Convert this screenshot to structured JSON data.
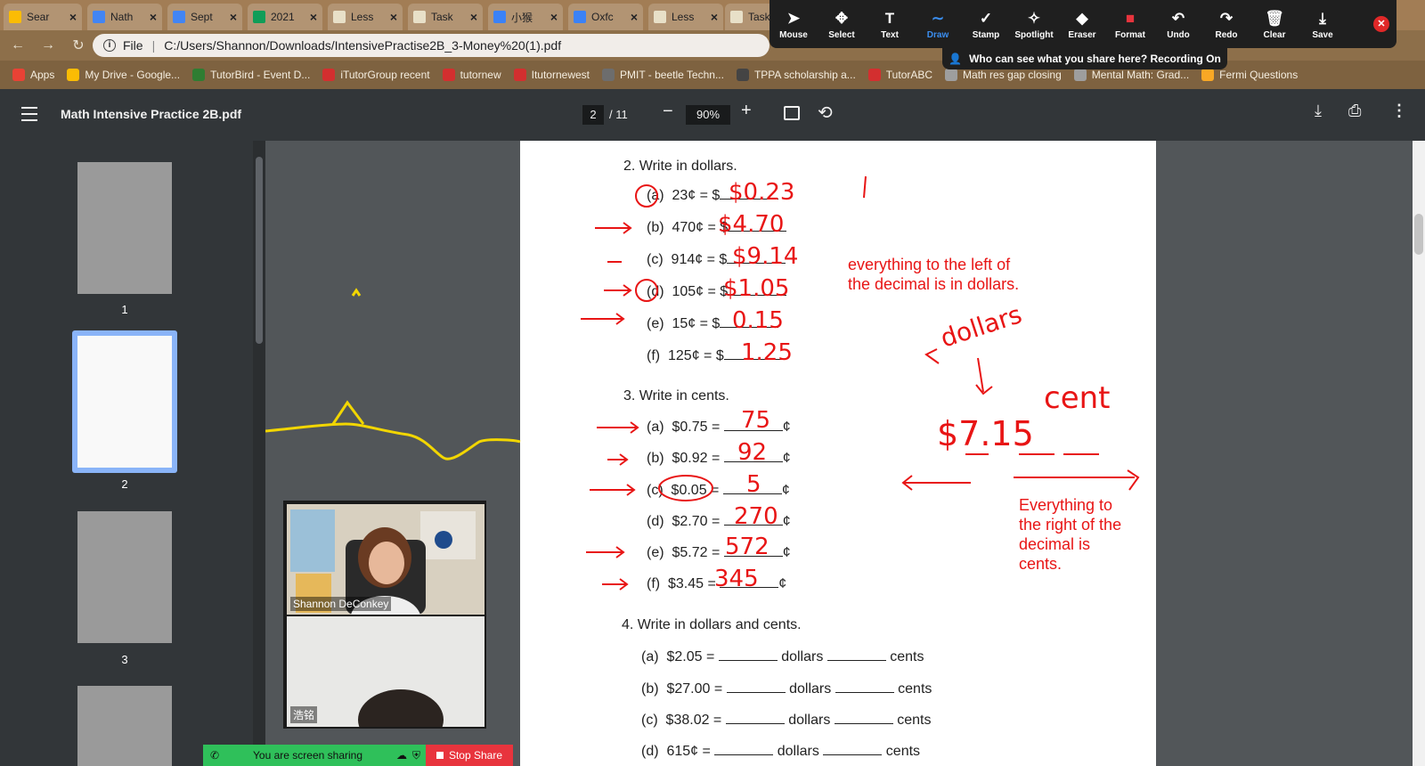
{
  "browser": {
    "tabs": [
      {
        "label": "Sear",
        "icon_color": "#fbbc04"
      },
      {
        "label": "Nath",
        "icon_color": "#4285f4"
      },
      {
        "label": "Sept",
        "icon_color": "#4285f4"
      },
      {
        "label": "2021",
        "icon_color": "#0f9d58"
      },
      {
        "label": "Less",
        "icon_color": "#e8e0c8"
      },
      {
        "label": "Task",
        "icon_color": "#e8e0c8"
      },
      {
        "label": "小猴",
        "icon_color": "#3b82f6"
      },
      {
        "label": "Oxfc",
        "icon_color": "#3b82f6"
      },
      {
        "label": "Less",
        "icon_color": "#e8e0c8"
      },
      {
        "label": "Task",
        "icon_color": "#e8e0c8"
      }
    ],
    "address": {
      "prefix": "File",
      "url": "C:/Users/Shannon/Downloads/IntensivePractise2B_3-Money%20(1).pdf"
    },
    "bookmarks": [
      {
        "label": "Apps",
        "icon_color": "#e94235"
      },
      {
        "label": "My Drive - Google...",
        "icon_color": "#fbbc04"
      },
      {
        "label": "TutorBird - Event D...",
        "icon_color": "#2e7d32"
      },
      {
        "label": "iTutorGroup recent",
        "icon_color": "#d32f2f"
      },
      {
        "label": "tutornew",
        "icon_color": "#d32f2f"
      },
      {
        "label": "Itutornewest",
        "icon_color": "#d32f2f"
      },
      {
        "label": "PMIT - beetle Techn...",
        "icon_color": "#6d6d6d"
      },
      {
        "label": "TPPA scholarship a...",
        "icon_color": "#444444"
      },
      {
        "label": "TutorABC",
        "icon_color": "#d32f2f"
      },
      {
        "label": "Math res gap closing",
        "icon_color": "#9e9e9e"
      },
      {
        "label": "Mental Math: Grad...",
        "icon_color": "#9e9e9e"
      },
      {
        "label": "Fermi Questions",
        "icon_color": "#f9a825"
      }
    ]
  },
  "zoom_annotate": {
    "tools": [
      {
        "label": "Mouse",
        "icon": "cursor-icon",
        "glyph": "➤",
        "active": false
      },
      {
        "label": "Select",
        "icon": "select-move-icon",
        "glyph": "✥",
        "active": false
      },
      {
        "label": "Text",
        "icon": "text-icon",
        "glyph": "T",
        "active": false
      },
      {
        "label": "Draw",
        "icon": "draw-icon",
        "glyph": "∼",
        "active": true
      },
      {
        "label": "Stamp",
        "icon": "stamp-check-icon",
        "glyph": "✓",
        "active": false
      },
      {
        "label": "Spotlight",
        "icon": "spotlight-icon",
        "glyph": "✧",
        "active": false
      },
      {
        "label": "Eraser",
        "icon": "eraser-icon",
        "glyph": "◆",
        "active": false
      },
      {
        "label": "Format",
        "icon": "format-color-icon",
        "glyph": "■",
        "active": false
      },
      {
        "label": "Undo",
        "icon": "undo-icon",
        "glyph": "↶",
        "active": false
      },
      {
        "label": "Redo",
        "icon": "redo-icon",
        "glyph": "↷",
        "active": false
      },
      {
        "label": "Clear",
        "icon": "trash-icon",
        "glyph": "🗑",
        "active": false
      },
      {
        "label": "Save",
        "icon": "save-icon",
        "glyph": "⤓",
        "active": false
      }
    ],
    "share_notice": "Who can see what you share here? Recording On"
  },
  "pdf": {
    "title": "Math Intensive Practice 2B.pdf",
    "current_page": "2",
    "total_pages": "/ 11",
    "zoom": "90%",
    "thumbnails": [
      "1",
      "2",
      "3"
    ]
  },
  "worksheet": {
    "q2": {
      "heading": "2.  Write in dollars.",
      "items": [
        {
          "label": "(a)",
          "expr": "23¢ = $"
        },
        {
          "label": "(b)",
          "expr": "470¢ = $"
        },
        {
          "label": "(c)",
          "expr": "914¢ = $"
        },
        {
          "label": "(d)",
          "expr": "105¢ = $"
        },
        {
          "label": "(e)",
          "expr": "15¢ = $"
        },
        {
          "label": "(f)",
          "expr": "125¢ = $"
        }
      ]
    },
    "q3": {
      "heading": "3.  Write in cents.",
      "items": [
        {
          "label": "(a)",
          "expr": "$0.75 ="
        },
        {
          "label": "(b)",
          "expr": "$0.92 ="
        },
        {
          "label": "(c)",
          "expr": "$0.05 ="
        },
        {
          "label": "(d)",
          "expr": "$2.70 ="
        },
        {
          "label": "(e)",
          "expr": "$5.72 ="
        },
        {
          "label": "(f)",
          "expr": "$3.45 ="
        }
      ],
      "unit": "¢"
    },
    "q4": {
      "heading": "4.  Write in dollars and cents.",
      "items": [
        {
          "label": "(a)",
          "expr": "$2.05 ="
        },
        {
          "label": "(b)",
          "expr": "$27.00 ="
        },
        {
          "label": "(c)",
          "expr": "$38.02 ="
        },
        {
          "label": "(d)",
          "expr": "615¢ ="
        }
      ],
      "word_dollars": "dollars",
      "word_cents": "cents"
    }
  },
  "annotations": {
    "q2_answers": [
      "$0.23",
      "$4.70",
      "$9.14",
      "$1.05",
      "0.15",
      "1.25"
    ],
    "q3_answers": [
      "75",
      "92",
      "5",
      "270",
      "572",
      "345"
    ],
    "note_left": [
      "everything to the left of",
      "the decimal is in dollars."
    ],
    "note_right": [
      "Everything to",
      "the right of the",
      "decimal is",
      "cents."
    ],
    "word_dollars": "dollars",
    "word_cent": "cent",
    "diagram_amount": "$7.15"
  },
  "video": {
    "participants": [
      {
        "name": "Shannon DeConkey"
      },
      {
        "name": "浩铭"
      }
    ]
  },
  "sharing": {
    "status": "You are screen sharing",
    "stop": "Stop Share"
  },
  "colors": {
    "ink_red": "#e81515",
    "ink_yellow": "#f2d600",
    "share_green": "#2fc05a",
    "stop_red": "#e8343d",
    "draw_active": "#3b8ef0"
  }
}
